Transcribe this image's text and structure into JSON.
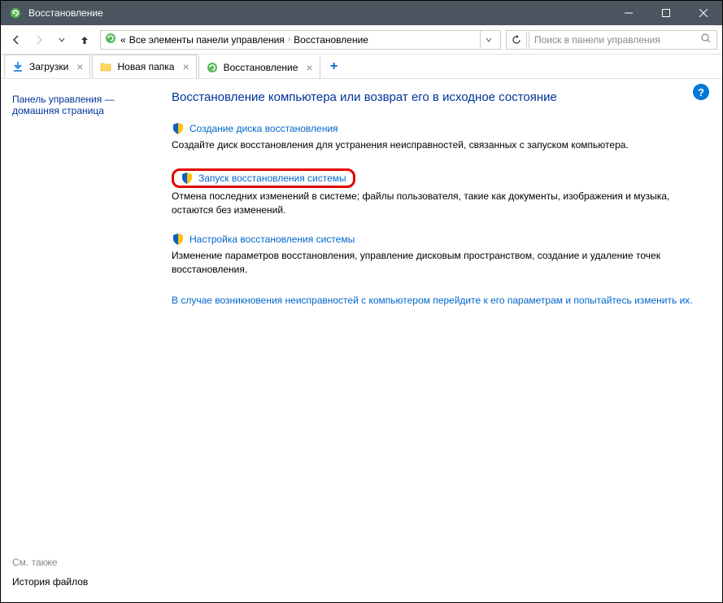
{
  "window": {
    "title": "Восстановление"
  },
  "nav": {
    "breadcrumb_prefix": "«",
    "breadcrumb1": "Все элементы панели управления",
    "breadcrumb2": "Восстановление",
    "search_placeholder": "Поиск в панели управления"
  },
  "tabs": [
    {
      "label": "Загрузки"
    },
    {
      "label": "Новая папка"
    },
    {
      "label": "Восстановление"
    }
  ],
  "sidebar": {
    "home_link": "Панель управления — домашняя страница",
    "see_also_label": "См. также",
    "history_link": "История файлов"
  },
  "main": {
    "heading": "Восстановление компьютера или возврат его в исходное состояние",
    "options": [
      {
        "link": "Создание диска восстановления",
        "desc": "Создайте диск восстановления для устранения неисправностей, связанных с запуском компьютера."
      },
      {
        "link": "Запуск восстановления системы",
        "desc": "Отмена последних изменений в системе; файлы пользователя, такие как документы, изображения и музыка, остаются без изменений."
      },
      {
        "link": "Настройка восстановления системы",
        "desc": "Изменение параметров восстановления, управление дисковым пространством, создание и удаление точек восстановления."
      }
    ],
    "troubleshoot": "В случае возникновения неисправностей с компьютером перейдите к его параметрам и попытайтесь изменить их."
  }
}
